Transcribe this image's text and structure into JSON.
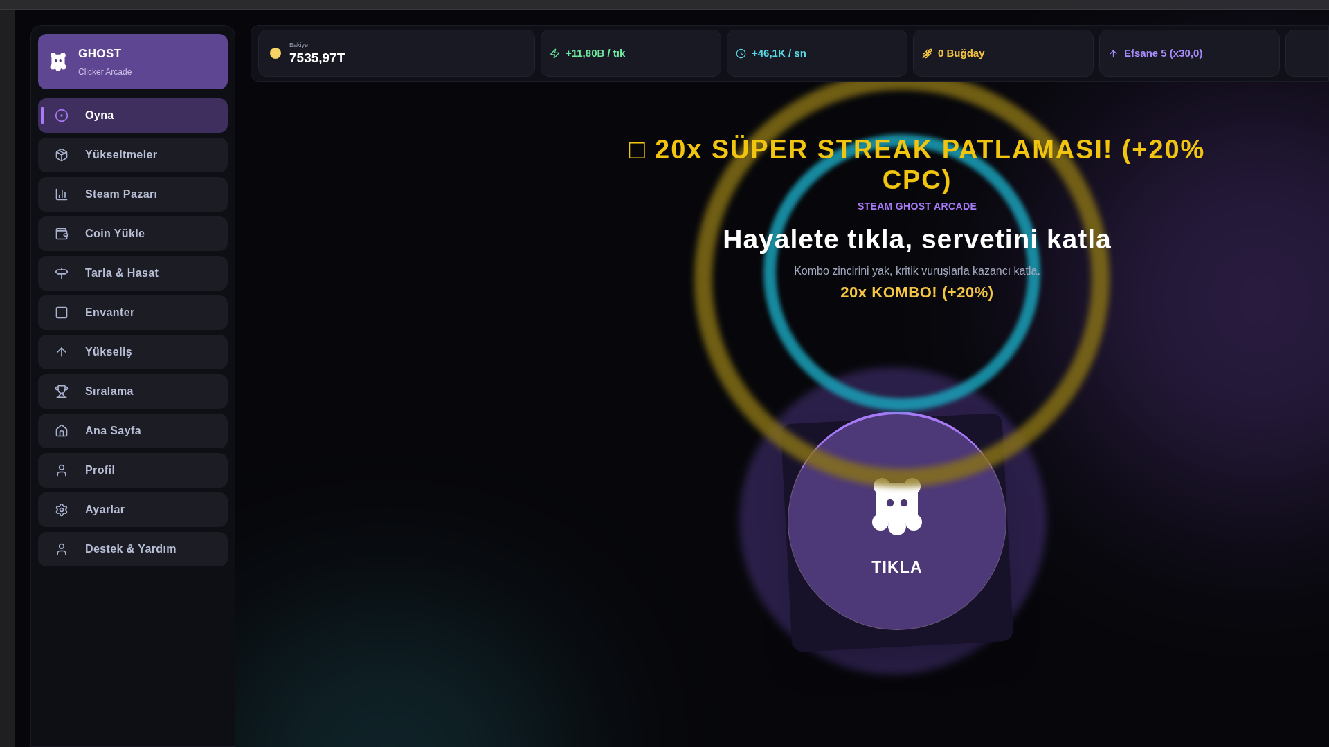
{
  "brand": {
    "title": "GHOST",
    "subtitle": "Clicker Arcade"
  },
  "nav": [
    {
      "label": "Oyna",
      "selected": true
    },
    {
      "label": "Yükseltmeler",
      "selected": false
    },
    {
      "label": "Steam Pazarı",
      "selected": false
    },
    {
      "label": "Coin Yükle",
      "selected": false
    },
    {
      "label": "Tarla & Hasat",
      "selected": false
    },
    {
      "label": "Envanter",
      "selected": false
    },
    {
      "label": "Yükseliş",
      "selected": false
    },
    {
      "label": "Sıralama",
      "selected": false
    },
    {
      "label": "Ana Sayfa",
      "selected": false
    },
    {
      "label": "Profil",
      "selected": false
    },
    {
      "label": "Ayarlar",
      "selected": false
    },
    {
      "label": "Destek & Yardım",
      "selected": false
    }
  ],
  "stats": [
    {
      "kind": "balance",
      "label": "Bakiye",
      "value": "7535,97T",
      "color": "#f6d365"
    },
    {
      "kind": "stat",
      "value": "+11,80B / tık",
      "color": "#6ee7a0"
    },
    {
      "kind": "stat",
      "value": "+46,1K / sn",
      "color": "#5ad8e6"
    },
    {
      "kind": "stat",
      "value": "0 Buğday",
      "color": "#f4c542"
    },
    {
      "kind": "stat",
      "value": "Efsane 5 (x30,0)",
      "color": "#a78bfa"
    }
  ],
  "hero": {
    "streak": "□ 20x SÜPER STREAK PATLAMASI! (+20% CPC)",
    "eyebrow": "STEAM GHOST ARCADE",
    "title": "Hayalete tıkla, servetini katla",
    "subtitle": "Kombo zincirini yak, kritik vuruşlarla kazancı katla.",
    "combo": "20x KOMBO! (+20%)"
  },
  "clicker": {
    "label": "TIKLA"
  }
}
